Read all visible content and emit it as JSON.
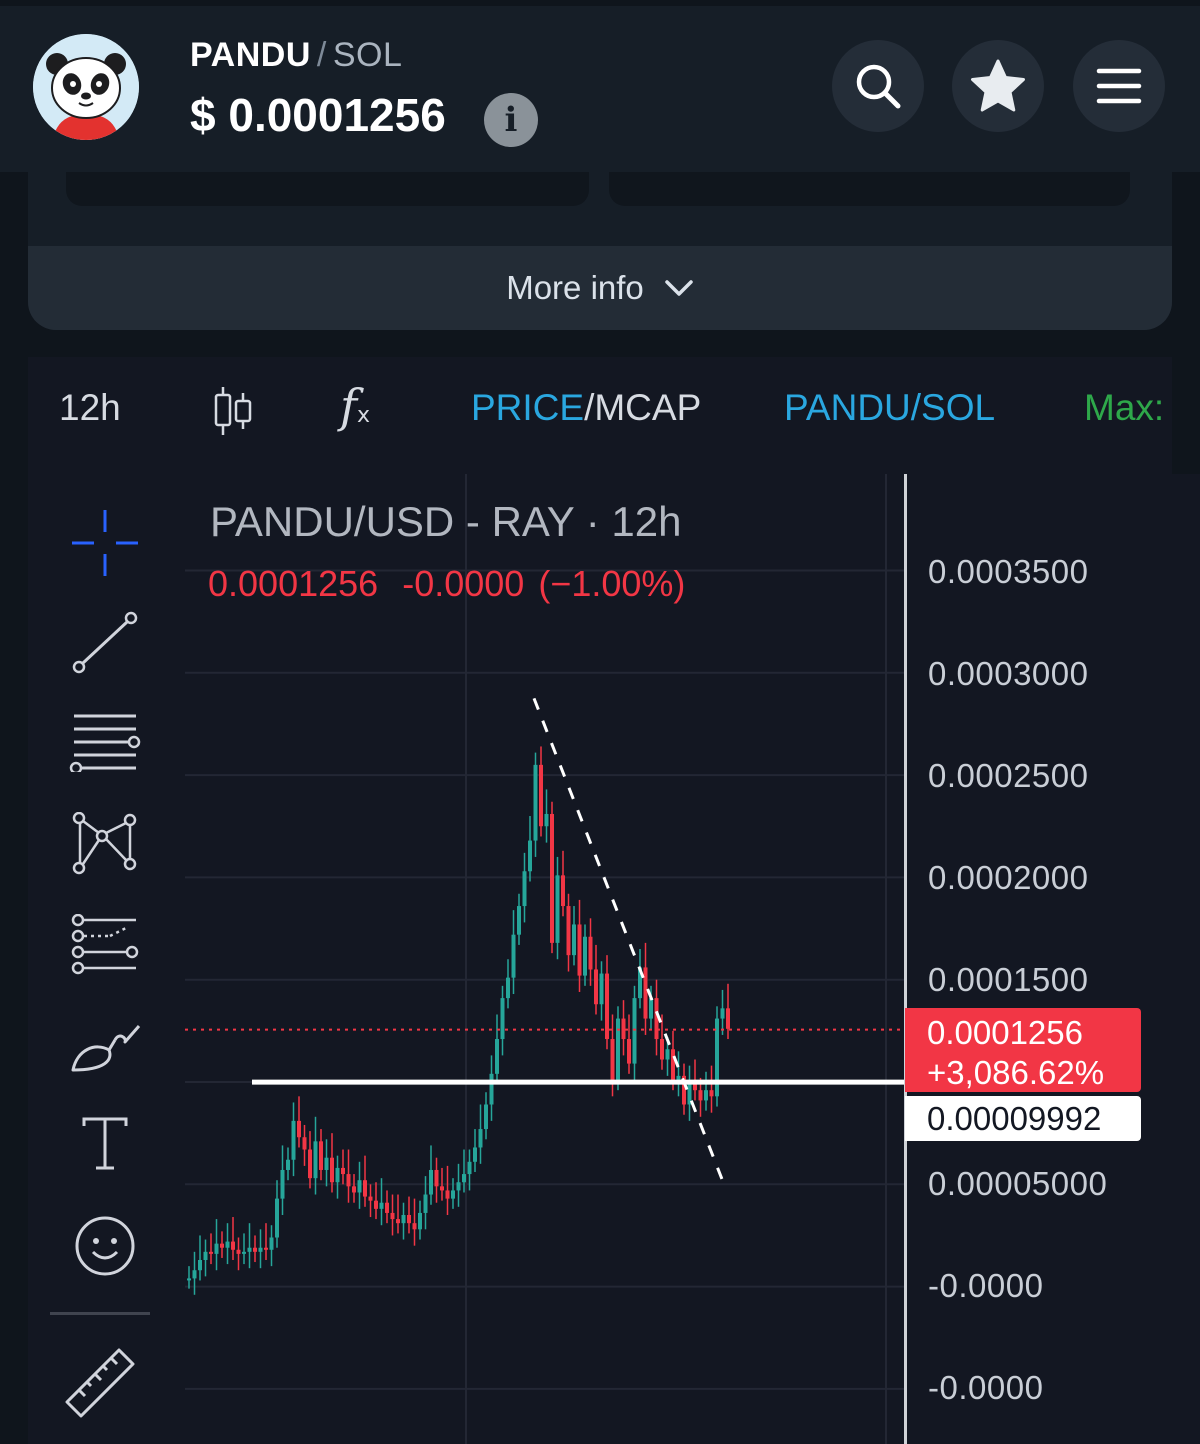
{
  "header": {
    "pair_base": "PANDU",
    "pair_separator": "/",
    "pair_quote": "SOL",
    "price": "$ 0.0001256",
    "info_glyph": "i",
    "buttons": [
      "search-icon",
      "star-icon",
      "menu-icon"
    ]
  },
  "summary": {
    "more_info_label": "More info"
  },
  "toolbar": {
    "interval": "12h",
    "indicators_icon": "fx-icon",
    "price_label": "PRICE",
    "mcap_label": "/MCAP",
    "pair_label": "PANDU/SOL",
    "max_label": "Max:"
  },
  "drawing_tools": [
    "crosshair-icon",
    "trend-line-icon",
    "horizontal-lines-icon",
    "pattern-icon",
    "fib-retracement-icon",
    "brush-icon",
    "text-icon",
    "emoji-icon",
    "ruler-icon"
  ],
  "legend": {
    "title": "PANDU/USD - RAY · 12h",
    "last": "0.0001256",
    "change": "-0.0000",
    "change_pct": "(−1.00%)"
  },
  "price_scale": {
    "ticks": [
      "0.0003500",
      "0.0003000",
      "0.0002500",
      "0.0002000",
      "0.0001500",
      "0.00005000",
      "-0.0000",
      "-0.0000"
    ],
    "last_price_label": "0.0001256",
    "last_price_change": "+3,086.62%",
    "horizontal_line_label": "0.00009992"
  },
  "colors": {
    "up": "#26a69a",
    "down": "#f23645",
    "accent_blue": "#2aa7e0",
    "max_green": "#2ea84a"
  },
  "chart_data": {
    "type": "candlestick",
    "title": "PANDU/USD - RAY · 12h",
    "interval": "12h",
    "y_axis_ticks": [
      0.00035,
      0.0003,
      0.00025,
      0.0002,
      0.00015,
      5e-05
    ],
    "ylim": [
      -5e-05,
      0.00037
    ],
    "last_price": 0.0001256,
    "horizontal_line": 9.992e-05,
    "trend_line": {
      "from_close": 0.00028,
      "to_close": 5e-05
    },
    "close_series": [
      4e-06,
      8e-06,
      1.3e-05,
      1.7e-05,
      1.6e-05,
      2.1e-05,
      1.9e-05,
      2.2e-05,
      1.8e-05,
      1.6e-05,
      1.7e-05,
      1.9e-05,
      1.7e-05,
      1.9e-05,
      1.8e-05,
      2.4e-05,
      4.3e-05,
      5.7e-05,
      6.2e-05,
      8.1e-05,
      7.3e-05,
      6.7e-05,
      5.3e-05,
      7.1e-05,
      5.7e-05,
      6.3e-05,
      5.1e-05,
      5.8e-05,
      5.5e-05,
      4.9e-05,
      4.6e-05,
      5.2e-05,
      4.4e-05,
      4.2e-05,
      3.8e-05,
      4.1e-05,
      3.6e-05,
      3.3e-05,
      3.1e-05,
      3.5e-05,
      3.1e-05,
      2.8e-05,
      3.6e-05,
      4.5e-05,
      5.7e-05,
      4.9e-05,
      4.7e-05,
      4.3e-05,
      4.7e-05,
      5.1e-05,
      5.5e-05,
      6.1e-05,
      6.8e-05,
      7.7e-05,
      8.9e-05,
      0.000104,
      0.000121,
      0.000141,
      0.000151,
      0.000172,
      0.000186,
      0.000203,
      0.000218,
      0.000255,
      0.000225,
      0.000231,
      0.000168,
      0.000201,
      0.000186,
      0.000162,
      0.000177,
      0.000152,
      0.000171,
      0.000155,
      0.000138,
      0.000153,
      0.000121,
      0.000101,
      0.000131,
      0.000121,
      0.000109,
      0.000141,
      0.000156,
      0.000131,
      0.000141,
      0.000121,
      0.000111,
      0.000116,
      0.000101,
      0.000103,
      8.9e-05,
      9.9e-05,
      9.6e-05,
      9.1e-05,
      9.6e-05,
      9.3e-05,
      0.000131,
      0.000136,
      0.000126
    ]
  }
}
